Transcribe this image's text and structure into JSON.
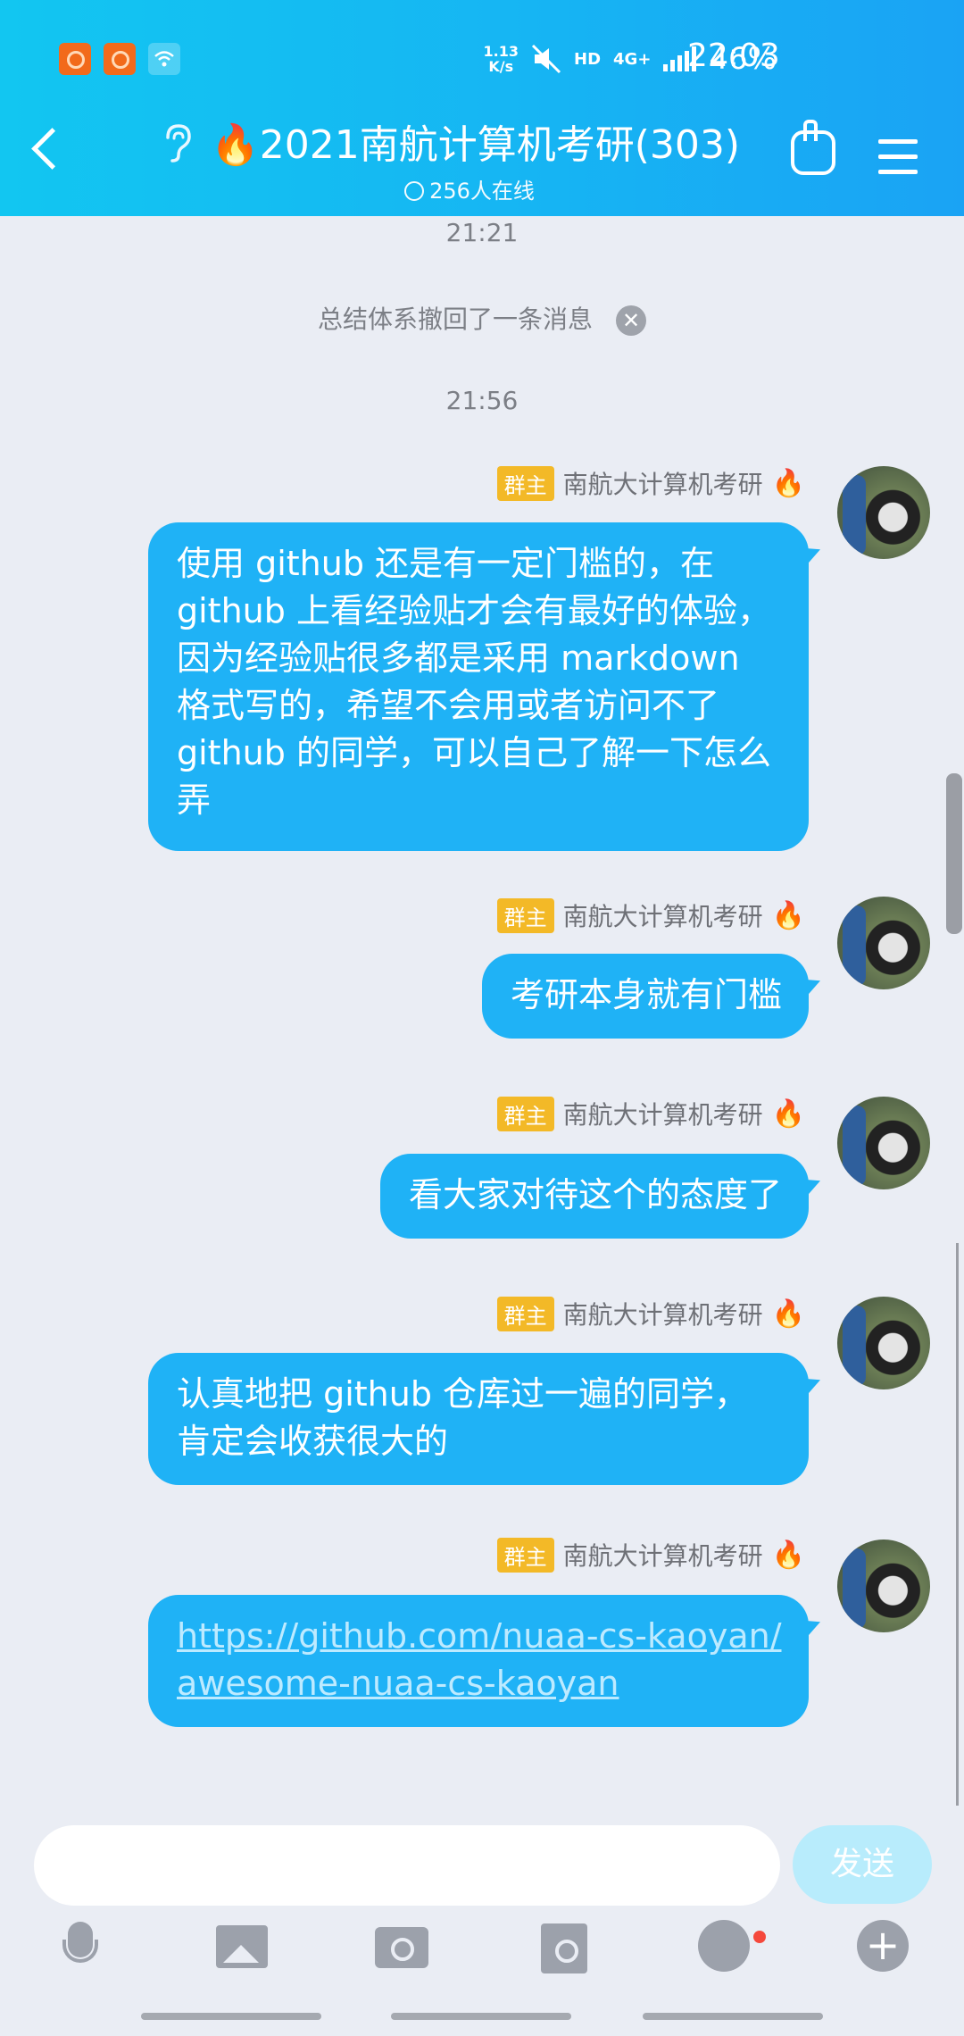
{
  "status_bar": {
    "speed_value": "1.13",
    "speed_unit": "K/s",
    "hd": "HD",
    "network": "4G+",
    "battery": "46%",
    "time": "22:03"
  },
  "header": {
    "title": "🔥2021南航计算机考研(303)",
    "online": "256人在线"
  },
  "chat": {
    "time_1": "21:21",
    "recall_notice": "总结体系撤回了一条消息",
    "time_2": "21:56",
    "sender_badge": "群主",
    "sender_name": "南航大计算机考研",
    "messages": [
      {
        "text": "使用 github 还是有一定门槛的，在 github 上看经验贴才会有最好的体验，因为经验贴很多都是采用 markdown 格式写的，希望不会用或者访问不了 github 的同学，可以自己了解一下怎么弄"
      },
      {
        "text": "考研本身就有门槛"
      },
      {
        "text": "看大家对待这个的态度了"
      },
      {
        "text": "认真地把 github 仓库过一遍的同学，肯定会收获很大的"
      },
      {
        "text": "https://github.com/nuaa-cs-kaoyan/awesome-nuaa-cs-kaoyan"
      }
    ]
  },
  "input": {
    "placeholder": "",
    "send_label": "发送"
  },
  "toolbar": {
    "icons": [
      "microphone-icon",
      "image-icon",
      "camera-icon",
      "red-packet-icon",
      "emoji-icon",
      "plus-icon"
    ]
  },
  "colors": {
    "header_start": "#12c6f1",
    "bubble": "#1fb2f6",
    "owner_badge": "#f3b927",
    "background": "#eaedf4"
  }
}
